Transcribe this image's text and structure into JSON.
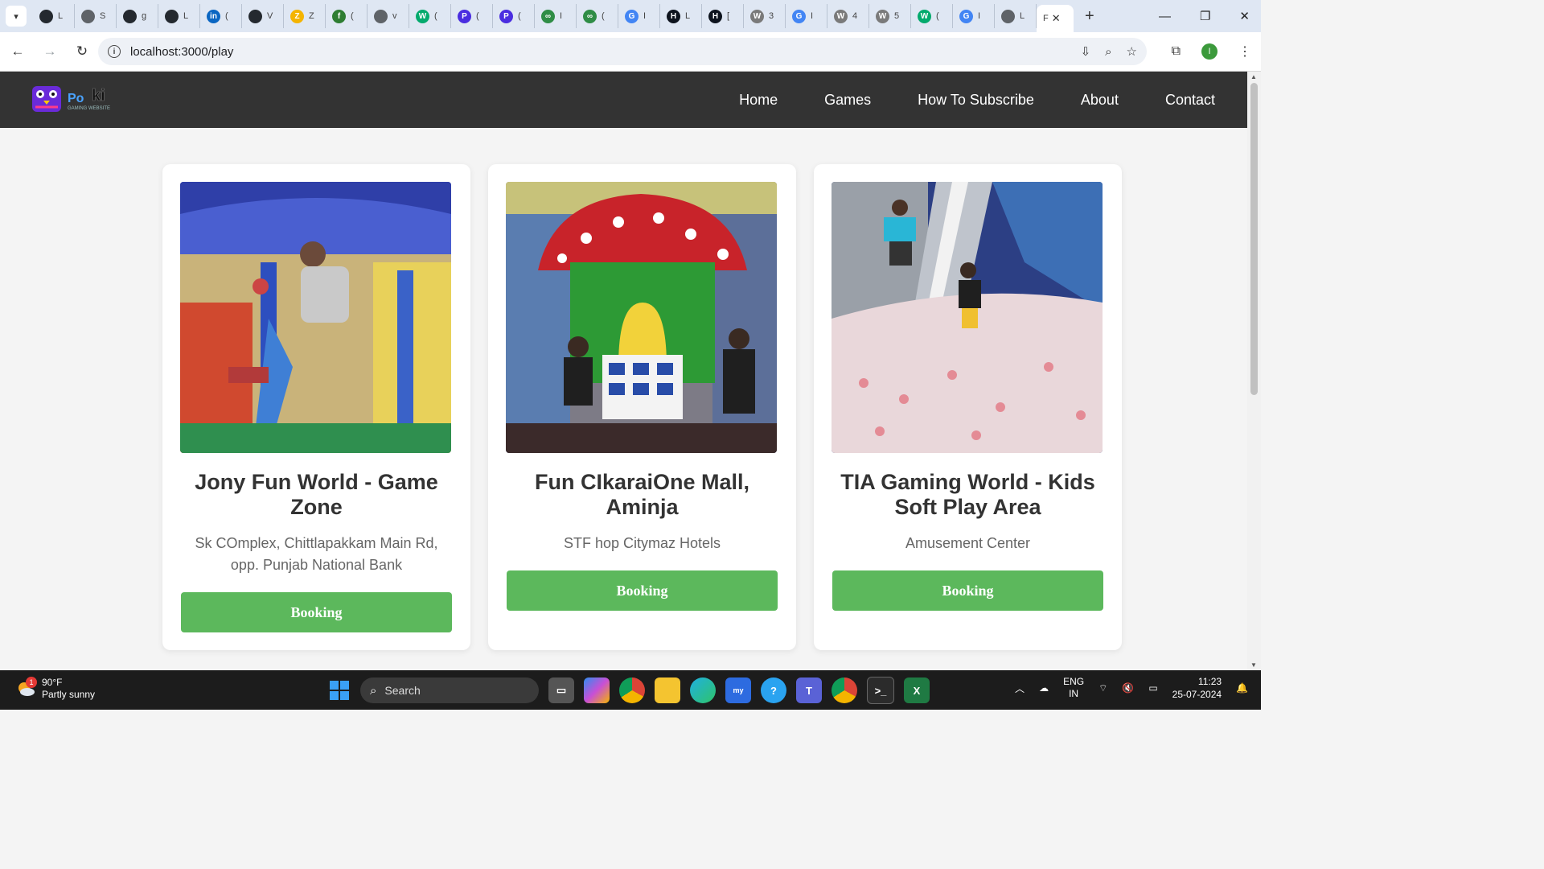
{
  "browser": {
    "tabs": [
      {
        "icon": "github-icon",
        "letter": "",
        "label": "L",
        "color": "#24292f"
      },
      {
        "icon": "globe-icon",
        "letter": "",
        "label": "S",
        "color": "#5f6368"
      },
      {
        "icon": "github-icon",
        "letter": "",
        "label": "g",
        "color": "#24292f"
      },
      {
        "icon": "github-icon",
        "letter": "",
        "label": "L",
        "color": "#24292f"
      },
      {
        "icon": "linkedin-icon",
        "letter": "in",
        "label": "(",
        "color": "#0a66c2"
      },
      {
        "icon": "github-icon",
        "letter": "",
        "label": "V",
        "color": "#24292f"
      },
      {
        "icon": "z-icon",
        "letter": "Z",
        "label": "Z",
        "color": "#f4b400"
      },
      {
        "icon": "green-circle-icon",
        "letter": "f",
        "label": "(",
        "color": "#2e7d32"
      },
      {
        "icon": "globe-icon",
        "letter": "",
        "label": "v",
        "color": "#5f6368"
      },
      {
        "icon": "w3-icon",
        "letter": "W",
        "label": "(",
        "color": "#04aa6d"
      },
      {
        "icon": "p-icon",
        "letter": "P",
        "label": "(",
        "color": "#4a2de0"
      },
      {
        "icon": "p-icon",
        "letter": "P",
        "label": "(",
        "color": "#4a2de0"
      },
      {
        "icon": "gfg-icon",
        "letter": "∞",
        "label": "I",
        "color": "#2f8d46"
      },
      {
        "icon": "gfg-icon",
        "letter": "∞",
        "label": "(",
        "color": "#2f8d46"
      },
      {
        "icon": "google-icon",
        "letter": "G",
        "label": "I",
        "color": "#4285f4"
      },
      {
        "icon": "hackerrank-icon",
        "letter": "H",
        "label": "L",
        "color": "#0e141e"
      },
      {
        "icon": "hackerrank-icon",
        "letter": "H",
        "label": "[",
        "color": "#0e141e"
      },
      {
        "icon": "w-icon",
        "letter": "W",
        "label": "3",
        "color": "#7a7a7a"
      },
      {
        "icon": "google-icon",
        "letter": "G",
        "label": "I",
        "color": "#4285f4"
      },
      {
        "icon": "w-icon",
        "letter": "W",
        "label": "4",
        "color": "#7a7a7a"
      },
      {
        "icon": "w-icon",
        "letter": "W",
        "label": "5",
        "color": "#7a7a7a"
      },
      {
        "icon": "w3-icon",
        "letter": "W",
        "label": "(",
        "color": "#04aa6d"
      },
      {
        "icon": "google-icon",
        "letter": "G",
        "label": "I",
        "color": "#4285f4"
      },
      {
        "icon": "globe-icon",
        "letter": "",
        "label": "L",
        "color": "#5f6368"
      }
    ],
    "active_tab": {
      "label": "F"
    },
    "url": "localhost:3000/play"
  },
  "site": {
    "logo_text": "Po",
    "logo_text_2": "ki",
    "logo_sub": "GAMING WEBSITE",
    "nav": [
      "Home",
      "Games",
      "How To Subscribe",
      "About",
      "Contact"
    ]
  },
  "cards": [
    {
      "title": "Jony Fun World - Game Zone",
      "address": "Sk COmplex, Chittlapakkam Main Rd, opp. Punjab National Bank",
      "button": "Booking"
    },
    {
      "title": "Fun CIkaraiOne Mall, Aminja",
      "address": "STF hop Citymaz Hotels",
      "button": "Booking"
    },
    {
      "title": "TIA Gaming World - Kids Soft Play Area",
      "address": "Amusement Center",
      "button": "Booking"
    }
  ],
  "taskbar": {
    "weather_badge": "1",
    "temperature": "90°F",
    "condition": "Partly sunny",
    "search_placeholder": "Search",
    "lang_1": "ENG",
    "lang_2": "IN",
    "time": "11:23",
    "date": "25-07-2024"
  }
}
